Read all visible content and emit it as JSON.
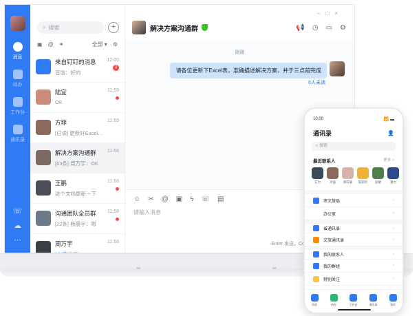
{
  "rail": {
    "items": [
      {
        "label": "消息",
        "active": true
      },
      {
        "label": "待办",
        "active": false
      },
      {
        "label": "工作台",
        "active": false
      },
      {
        "label": "通讯录",
        "active": false
      }
    ],
    "bottom_icons": [
      "phone-icon",
      "cloud-icon",
      "more-icon"
    ]
  },
  "list": {
    "search_placeholder": "搜索",
    "filter_all": "全部",
    "conversations": [
      {
        "name": "来自钉钉的消息",
        "preview": "音信：好的",
        "time": "12:00",
        "badge": "3",
        "avatar_color": "#2f7bf5"
      },
      {
        "name": "陆宜",
        "preview": "OK",
        "time": "11:59",
        "dot": true,
        "avatar_color": "#c98d7a"
      },
      {
        "name": "方菲",
        "preview": "[已读] 更新好Excel表...",
        "time": "11:59",
        "avatar_color": "#8b6a5d"
      },
      {
        "name": "解决方案沟通群",
        "preview": "[63条] 周万宇：OK",
        "time": "11:58",
        "selected": true,
        "avatar_color": "#7c6b62"
      },
      {
        "name": "王鹏",
        "preview": "这个文档更新一下",
        "time": "11:58",
        "dot": true,
        "avatar_color": "#4a4f57"
      },
      {
        "name": "沟通团队全员群",
        "preview": "[22条] 杨晨宇：嗯",
        "time": "11:58",
        "dot": true,
        "avatar_color": "#6d7a8a"
      },
      {
        "name": "周万宇",
        "preview_unread": "[未读]",
        "preview": "收到",
        "time": "11:58",
        "avatar_color": "#3c3f44"
      }
    ]
  },
  "chat": {
    "title": "解决方案沟通群",
    "time_divider": "刚刚",
    "message": "请各位更新下Excel表，准确描述解决方案，并于三点前完成",
    "read_status": "6人未读",
    "input_placeholder": "请输入消息",
    "send_hint": "Enter 发送，Command+Enter 换行"
  },
  "phone": {
    "time": "10:00",
    "signal": "📶 ▬",
    "title": "通讯录",
    "search_placeholder": "搜索",
    "recent_title": "最近联系人",
    "recent_more": "更多 >",
    "recent": [
      {
        "name": "方力",
        "color": "#3d4a5c"
      },
      {
        "name": "肖强",
        "color": "#8b6a5d"
      },
      {
        "name": "郑轩展",
        "color": "#d9b3a8"
      },
      {
        "name": "陈丽珍",
        "color": "#f2b23a"
      },
      {
        "name": "赵敏",
        "color": "#4f7f4a"
      },
      {
        "name": "潘力",
        "color": "#2f4a8a"
      }
    ],
    "rows": [
      {
        "label": "市文旅局",
        "icon_color": "#2f7bf5",
        "gap": false
      },
      {
        "label": "办公室",
        "icon_color": "#ffffff",
        "gap": false
      },
      {
        "label": "省通讯录",
        "icon_color": "#2f7bf5",
        "gap": true
      },
      {
        "label": "文旅通讯录",
        "icon_color": "#ff8a00",
        "gap": false
      },
      {
        "label": "我的联系人",
        "icon_color": "#2f7bf5",
        "gap": true
      },
      {
        "label": "我的群组",
        "icon_color": "#2f7bf5",
        "gap": false
      },
      {
        "label": "特别关注",
        "icon_color": "#ffc53d",
        "gap": false
      }
    ],
    "tabs": [
      {
        "label": "消息",
        "color": "#2f7bf5"
      },
      {
        "label": "待办",
        "color": "#2bb673"
      },
      {
        "label": "工作台",
        "color": "#2f7bf5"
      },
      {
        "label": "通讯录",
        "color": "#2f7bf5"
      },
      {
        "label": "我的",
        "color": "#2f7bf5"
      }
    ]
  }
}
